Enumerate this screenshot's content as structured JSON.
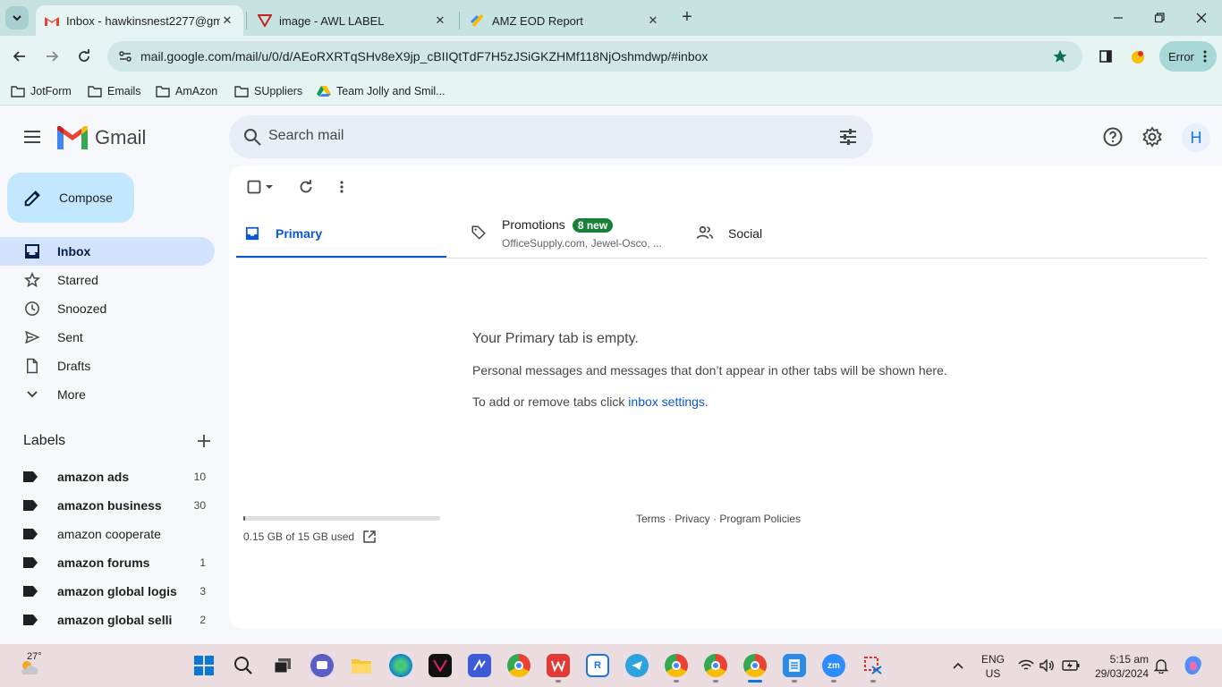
{
  "browser": {
    "tabs": [
      {
        "title": "Inbox - hawkinsnest2277@gma",
        "icon": "gmail-icon",
        "active": true
      },
      {
        "title": "image - AWL LABEL",
        "icon": "awl-icon",
        "active": false
      },
      {
        "title": "AMZ EOD Report",
        "icon": "report-icon",
        "active": false
      }
    ],
    "url": "mail.google.com/mail/u/0/d/AEoRXRTqSHv8eX9jp_cBIIQtTdF7H5zJSiGKZHMf118NjOshmdwp/#inbox",
    "error_label": "Error",
    "bookmarks": [
      {
        "label": "JotForm",
        "icon": "folder-icon"
      },
      {
        "label": "Emails",
        "icon": "folder-icon"
      },
      {
        "label": "AmAzon",
        "icon": "folder-icon"
      },
      {
        "label": "SUppliers",
        "icon": "folder-icon"
      },
      {
        "label": "Team Jolly and Smil...",
        "icon": "drive-icon"
      }
    ]
  },
  "gmail": {
    "product_name": "Gmail",
    "search_placeholder": "Search mail",
    "avatar_letter": "H",
    "compose_label": "Compose",
    "nav": [
      {
        "label": "Inbox",
        "icon": "inbox-icon",
        "active": true
      },
      {
        "label": "Starred",
        "icon": "star-icon",
        "active": false
      },
      {
        "label": "Snoozed",
        "icon": "clock-icon",
        "active": false
      },
      {
        "label": "Sent",
        "icon": "send-icon",
        "active": false
      },
      {
        "label": "Drafts",
        "icon": "draft-icon",
        "active": false
      },
      {
        "label": "More",
        "icon": "chevron-down-icon",
        "active": false
      }
    ],
    "labels_title": "Labels",
    "labels": [
      {
        "name": "amazon ads",
        "count": "10",
        "bold": true
      },
      {
        "name": "amazon business",
        "count": "30",
        "bold": true
      },
      {
        "name": "amazon cooperate",
        "count": "",
        "bold": false
      },
      {
        "name": "amazon forums",
        "count": "1",
        "bold": true
      },
      {
        "name": "amazon global logis",
        "count": "3",
        "bold": true
      },
      {
        "name": "amazon global selli",
        "count": "2",
        "bold": true
      }
    ],
    "tabs": {
      "primary": "Primary",
      "promotions": "Promotions",
      "promotions_badge": "8 new",
      "promotions_sub": "OfficeSupply.com, Jewel-Osco, ...",
      "social": "Social"
    },
    "empty": {
      "title": "Your Primary tab is empty.",
      "line1": "Personal messages and messages that don’t appear in other tabs will be shown here.",
      "line2_prefix": "To add or remove tabs click ",
      "line2_link": "inbox settings",
      "line2_suffix": "."
    },
    "storage": {
      "text": "0.15 GB of 15 GB used",
      "fraction_used": 0.01
    },
    "footer": "Terms · Privacy · Program Policies"
  },
  "taskbar": {
    "weather": "27°",
    "lang_line1": "ENG",
    "lang_line2": "US",
    "time": "5:15 am",
    "date": "29/03/2024",
    "apps": [
      "windows-start-icon",
      "search-icon",
      "task-view-icon",
      "teams-icon",
      "file-explorer-icon",
      "edge-icon",
      "app-icon",
      "app-icon",
      "chrome-icon",
      "wps-icon",
      "app-icon",
      "telegram-icon",
      "chrome-icon",
      "chrome-icon",
      "chrome-icon",
      "notepad-icon",
      "zoom-icon",
      "snipping-icon"
    ]
  }
}
